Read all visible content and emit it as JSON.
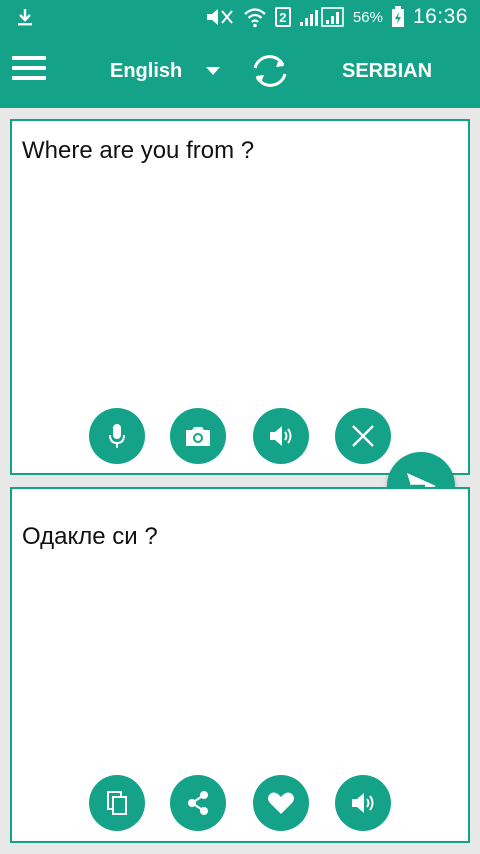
{
  "status_bar": {
    "battery_percent": "56%",
    "time": "16:36",
    "sim_slot": "2",
    "icons": [
      "download-icon",
      "mute-icon",
      "wifi-icon",
      "sim-icon",
      "signal-icon",
      "battery-icon"
    ]
  },
  "app_bar": {
    "source_language": "English",
    "target_language": "SERBIAN",
    "icons": [
      "menu-icon",
      "dropdown-arrow-icon",
      "swap-languages-icon"
    ]
  },
  "input_panel": {
    "text": "Where are you from ?",
    "actions": [
      "microphone-icon",
      "camera-icon",
      "speaker-icon",
      "clear-icon"
    ]
  },
  "output_panel": {
    "text": "Одакле си ?",
    "actions": [
      "copy-icon",
      "share-icon",
      "favorite-icon",
      "speaker-icon"
    ]
  },
  "colors": {
    "accent": "#14a388",
    "panel_bg": "#ffffff",
    "page_bg": "#e8e8e8",
    "text": "#111111"
  }
}
